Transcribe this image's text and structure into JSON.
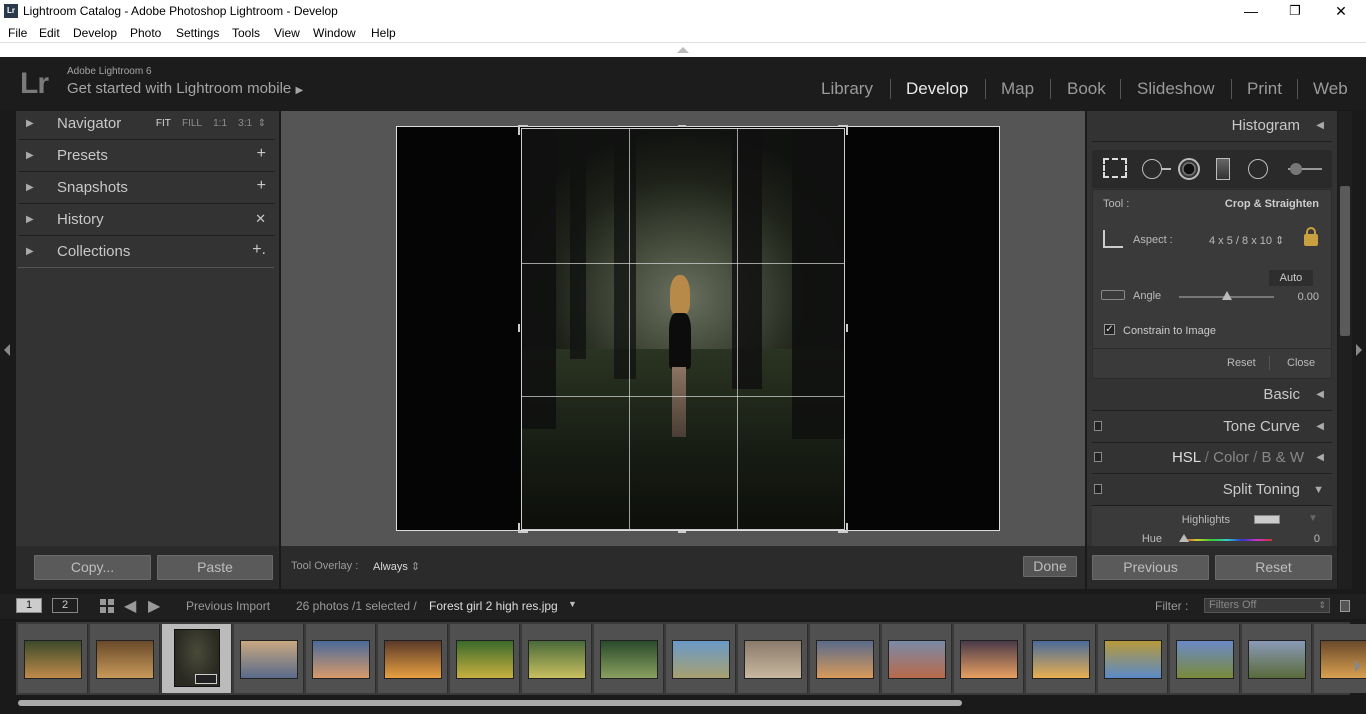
{
  "window": {
    "title": "Lightroom Catalog - Adobe Photoshop Lightroom - Develop",
    "app_icon": "Lr",
    "minimize": "—",
    "maximize": "❐",
    "close": "✕"
  },
  "menu": [
    "File",
    "Edit",
    "Develop",
    "Photo",
    "Settings",
    "Tools",
    "View",
    "Window",
    "Help"
  ],
  "identity": {
    "logo": "Lr",
    "product": "Adobe Lightroom 6",
    "tagline": "Get started with Lightroom mobile",
    "tagline_arrow": "▶"
  },
  "modules": [
    "Library",
    "Develop",
    "Map",
    "Book",
    "Slideshow",
    "Print",
    "Web"
  ],
  "active_module": "Develop",
  "left_panels": {
    "navigator": {
      "label": "Navigator",
      "opts": [
        "FIT",
        "FILL",
        "1:1",
        "3:1"
      ],
      "more": "⇕"
    },
    "presets": {
      "label": "Presets",
      "action": "+"
    },
    "snapshots": {
      "label": "Snapshots",
      "action": "+"
    },
    "history": {
      "label": "History",
      "action": "✕"
    },
    "collections": {
      "label": "Collections",
      "action": "+."
    }
  },
  "left_buttons": {
    "copy": "Copy...",
    "paste": "Paste"
  },
  "toolbar": {
    "overlay_label": "Tool Overlay :",
    "overlay_value": "Always",
    "overlay_arrows": "⇕",
    "done": "Done"
  },
  "right_panels": {
    "histogram": "Histogram",
    "crop": {
      "tool_label": "Tool :",
      "tool_value": "Crop & Straighten",
      "aspect_label": "Aspect :",
      "aspect_value": "4 x 5  /  8 x 10",
      "aspect_arrows": "⇕",
      "auto": "Auto",
      "angle_label": "Angle",
      "angle_value": "0.00",
      "angle_fraction": 0.5,
      "constrain_label": "Constrain to Image",
      "constrain_checked": true,
      "reset": "Reset",
      "close": "Close"
    },
    "basic": "Basic",
    "tone_curve": "Tone Curve",
    "hsl": {
      "hsl": "HSL",
      "sep": "/",
      "color": "Color",
      "bw": "B & W"
    },
    "split_toning": {
      "label": "Split Toning",
      "highlights": "Highlights",
      "hue": "Hue",
      "hue_value": "0"
    }
  },
  "right_buttons": {
    "previous": "Previous",
    "reset": "Reset"
  },
  "filmstrip_bar": {
    "screen1": "1",
    "screen2": "2",
    "source": "Previous Import",
    "count": "26 photos /1 selected /",
    "filename": "Forest girl 2 high res.jpg",
    "filter_label": "Filter :",
    "filter_value": "Filters Off"
  },
  "thumbnails": [
    {
      "c1": "#3b4a2a",
      "c2": "#c08a4a"
    },
    {
      "c1": "#6a4a2a",
      "c2": "#c89a5a"
    },
    {
      "c1": "#2a2a22",
      "c2": "#4a4a3a",
      "selected": true
    },
    {
      "c1": "#c8a880",
      "c2": "#5a6a8a"
    },
    {
      "c1": "#4a6a9a",
      "c2": "#d89a6a"
    },
    {
      "c1": "#5a3a2a",
      "c2": "#e8a040"
    },
    {
      "c1": "#3a6a2a",
      "c2": "#c8b040"
    },
    {
      "c1": "#4a6a3a",
      "c2": "#c8c060"
    },
    {
      "c1": "#2a4a2a",
      "c2": "#8aa060"
    },
    {
      "c1": "#6a9ac8",
      "c2": "#a8a070"
    },
    {
      "c1": "#8a7a6a",
      "c2": "#c8b8a0"
    },
    {
      "c1": "#5a6a8a",
      "c2": "#d89a5a"
    },
    {
      "c1": "#7a8aa8",
      "c2": "#b86a4a"
    },
    {
      "c1": "#4a3a4a",
      "c2": "#e8a060"
    },
    {
      "c1": "#4a6a9a",
      "c2": "#e8b050"
    },
    {
      "c1": "#b89a3a",
      "c2": "#5a8ac8"
    },
    {
      "c1": "#6a8ac8",
      "c2": "#7a8a3a"
    },
    {
      "c1": "#8a9ab8",
      "c2": "#5a6a3a"
    },
    {
      "c1": "#6a4a2a",
      "c2": "#d8a050"
    }
  ]
}
